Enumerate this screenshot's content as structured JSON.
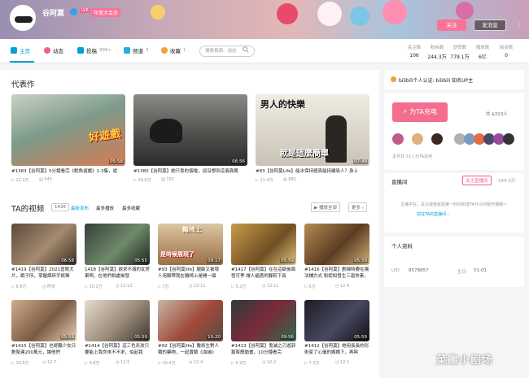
{
  "header": {
    "username": "谷阿莫",
    "level": "LV6",
    "vip": "年度大会员",
    "follow": "关注",
    "message": "发消息",
    "more": "⋮"
  },
  "nav": {
    "tabs": [
      {
        "label": "主页",
        "count": ""
      },
      {
        "label": "动态",
        "count": ""
      },
      {
        "label": "投稿",
        "count": "999+"
      },
      {
        "label": "频道",
        "count": "3"
      },
      {
        "label": "收藏",
        "count": "1"
      }
    ],
    "search_placeholder": "搜索视频、动态",
    "stats": [
      {
        "label": "关注数",
        "value": "106"
      },
      {
        "label": "粉丝数",
        "value": "244.3万"
      },
      {
        "label": "获赞数",
        "value": "779.1万"
      },
      {
        "label": "播放数",
        "value": "6亿"
      },
      {
        "label": "阅读数",
        "value": "0"
      }
    ]
  },
  "featured": {
    "heading": "代表作",
    "items": [
      {
        "title": "#1383【谷阿莫】5分鐘看完《魷魚遊戲》1-3集，遊",
        "duration": "05:58",
        "plays": "12.3万",
        "comments": "545"
      },
      {
        "title": "#1380【谷阿莫】她只靠約個電，卻沒想到這個真媽",
        "duration": "06:56",
        "plays": "28.6万",
        "comments": "725"
      },
      {
        "title": "#83【谷阿莫Life】能冰保持極真能持續吸人？身上",
        "duration": "07:49",
        "plays": "11.4万",
        "comments": "681"
      }
    ],
    "overlay1": "好遊戲",
    "overlay3a": "男人的快樂",
    "overlay3b": "就是這麼簡單"
  },
  "videos": {
    "heading": "TA的视频",
    "count": "1435",
    "sort": [
      "最新发布",
      "最多播放",
      "最多收藏"
    ],
    "play_all": "播放全部",
    "more": "更多",
    "overlay3": "輪椅上",
    "overlay3b": "是時候展現了",
    "items": [
      {
        "title": "#1419【谷阿莫】2021冒險犬片，戳子所，掌握諜碎手統稀",
        "duration": "06:58",
        "plays": "6.6万",
        "date": "昨天"
      },
      {
        "title": "1418【谷阿莫】欲求不滿的女房東啊，在他們相處後發",
        "duration": "05:55",
        "plays": "10.1万",
        "date": "12-13"
      },
      {
        "title": "#93【谷阿莫life】腿斷又被壞人用腳帶我在輪椅上是開一個",
        "duration": "09:17",
        "plays": "7万",
        "date": "12-12"
      },
      {
        "title": "#1417【谷阿莫】在在這斷後面發可爭 讓人緬勇的腳較下長",
        "duration": "05:59",
        "plays": "5.2万",
        "date": "12-11"
      },
      {
        "title": "#1416【谷阿莫】劃婦時要在讓法鋪方式 和認知發生三迦命素，",
        "duration": "05:59",
        "plays": "5万",
        "date": "12-9"
      },
      {
        "title": "#1415【谷阿莫】也將聽少女日數幫連200萬元，讓他們",
        "duration": "05:59",
        "plays": "10.6万",
        "date": "12-7"
      },
      {
        "title": "#1414【谷阿莫】這三色杀孩只要能上我命來不不求，伯起我",
        "duration": "05:59",
        "plays": "9.8万",
        "date": "12-5"
      },
      {
        "title": "#92【谷阿莫life】醫術生對人類的藥物，一起實驗《血緣》",
        "duration": "10:20",
        "plays": "10.4万",
        "date": "12-4"
      },
      {
        "title": "#1413【谷阿莫】鬼滅之刃遊郭篇幫應動畫，10分鐘看完",
        "duration": "09:56",
        "plays": "6.9万",
        "date": "12-2"
      },
      {
        "title": "#1412【谷阿莫】她用長長的形術家了心儀的媽媽下，再與",
        "duration": "05:59",
        "plays": "7.3万",
        "date": "12-1"
      }
    ]
  },
  "side": {
    "verify": "bilibili个人认证: bilibili 知名UP主",
    "charge_btn": "为TA充电",
    "charge_count": "共 $313人",
    "charge_note": "本月共 11人为TA充电",
    "live_heading": "直播间",
    "live_btn": "关注直播间",
    "live_fans": "244.3万",
    "live_empty": "主播不在，关注或者就能第一时间知道TA什么时候开播哦～",
    "live_link": "前往TA的直播间",
    "profile_heading": "个人资料",
    "uid_label": "UID",
    "uid": "8578857",
    "bday_label": "生日",
    "bday": "01-01"
  },
  "watermark": "菜雕小剧场"
}
